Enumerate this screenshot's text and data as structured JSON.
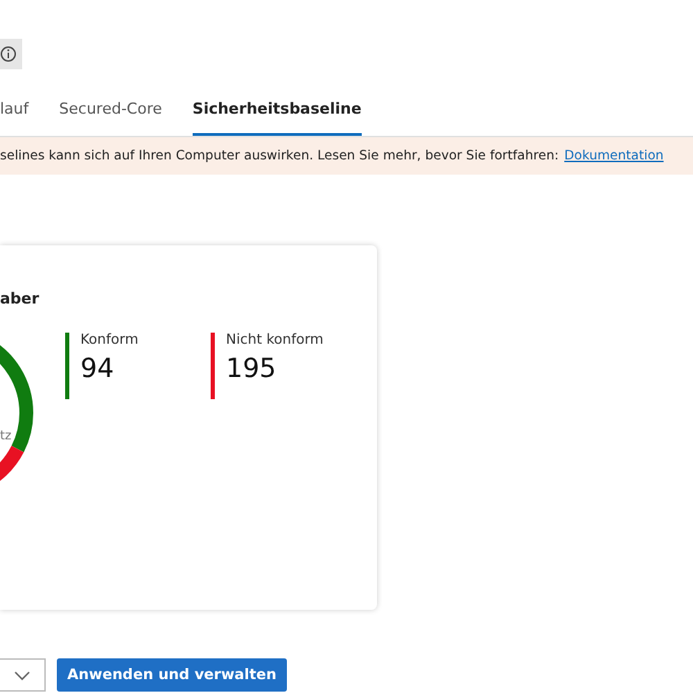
{
  "tabs": [
    {
      "label": "lauf",
      "selected": false
    },
    {
      "label": "Secured-Core",
      "selected": false
    },
    {
      "label": "Sicherheitsbaseline",
      "selected": true
    }
  ],
  "banner": {
    "text": "selines kann sich auf Ihren Computer auswirken. Lesen Sie mehr, bevor Sie fortfahren:",
    "link": "Dokumentation"
  },
  "card": {
    "title": "aber",
    "center_label": "tz",
    "legend": [
      {
        "label": "Konform",
        "value": "94",
        "color": "#107c10"
      },
      {
        "label": "Nicht konform",
        "value": "195",
        "color": "#e81123"
      }
    ]
  },
  "apply_button": "Anwenden und verwalten"
}
